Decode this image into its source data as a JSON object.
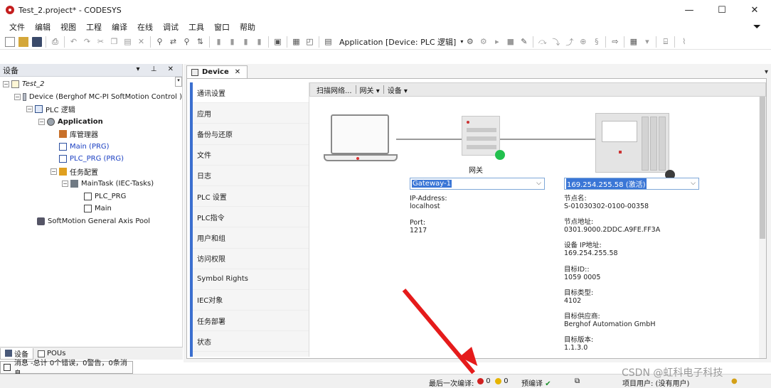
{
  "window": {
    "title": "Test_2.project* - CODESYS",
    "controls": [
      "—",
      "☐",
      "✕"
    ]
  },
  "menu": [
    "文件",
    "编辑",
    "视图",
    "工程",
    "编译",
    "在线",
    "调试",
    "工具",
    "窗口",
    "帮助"
  ],
  "toolbar": {
    "application_combo": "Application [Device: PLC 逻辑]"
  },
  "left_panel": {
    "header": "设备",
    "header_controls": "▾ ⊥ ✕",
    "tree": [
      {
        "label": "Test_2",
        "icon": "project-icon"
      },
      {
        "label": "Device (Berghof MC-PI SoftMotion Control )",
        "icon": "device-icon"
      },
      {
        "label": "PLC 逻辑",
        "icon": "plc-logic-icon"
      },
      {
        "label": "Application",
        "icon": "application-icon"
      },
      {
        "label": "库管理器",
        "icon": "library-manager-icon"
      },
      {
        "label": "Main (PRG)",
        "icon": "program-icon"
      },
      {
        "label": "PLC_PRG (PRG)",
        "icon": "program-icon"
      },
      {
        "label": "任务配置",
        "icon": "task-config-icon"
      },
      {
        "label": "MainTask (IEC-Tasks)",
        "icon": "task-icon"
      },
      {
        "label": "PLC_PRG",
        "icon": "pou-call-icon"
      },
      {
        "label": "Main",
        "icon": "pou-call-icon"
      },
      {
        "label": "SoftMotion General Axis Pool",
        "icon": "axis-pool-icon"
      }
    ],
    "tabs": [
      "设备",
      "POUs"
    ]
  },
  "messages": {
    "label": "消息 -总计 0个错误，0警告，0条消息"
  },
  "editor": {
    "tab_label": "Device",
    "nav_items": [
      "通讯设置",
      "应用",
      "备份与还原",
      "文件",
      "日志",
      "PLC 设置",
      "PLC指令",
      "用户和组",
      "访问权限",
      "Symbol Rights",
      "IEC对象",
      "任务部署",
      "状态"
    ],
    "active_nav": "通讯设置",
    "comm_toolbar": [
      "扫描网络...",
      "网关 ▾",
      "设备 ▾"
    ],
    "gateway": {
      "caption": "网关",
      "combo": "Gateway-1",
      "ip_label": "IP-Address:",
      "ip_value": "localhost",
      "port_label": "Port:",
      "port_value": "1217"
    },
    "device": {
      "combo": "169.254.255.58 (激活)",
      "node_name_label": "节点名:",
      "node_name": "S-01030302-0100-00358",
      "node_addr_label": "节点地址:",
      "node_addr": "0301.9000.2DDC.A9FE.FF3A",
      "ip_label": "设备 IP地址:",
      "ip": "169.254.255.58",
      "target_id_label": "目标ID::",
      "target_id": "1059  0005",
      "target_type_label": "目标类型:",
      "target_type": "4102",
      "vendor_label": "目标供应商:",
      "vendor": "Berghof Automation GmbH",
      "version_label": "目标版本:",
      "version": "1.1.3.0"
    }
  },
  "statusbar": {
    "last_build": "最后一次编译:",
    "errors": "0",
    "warnings": "0",
    "precompile": "预编译",
    "user": "项目用户: (没有用户)"
  },
  "watermark": "CSDN @虹科电子科技"
}
